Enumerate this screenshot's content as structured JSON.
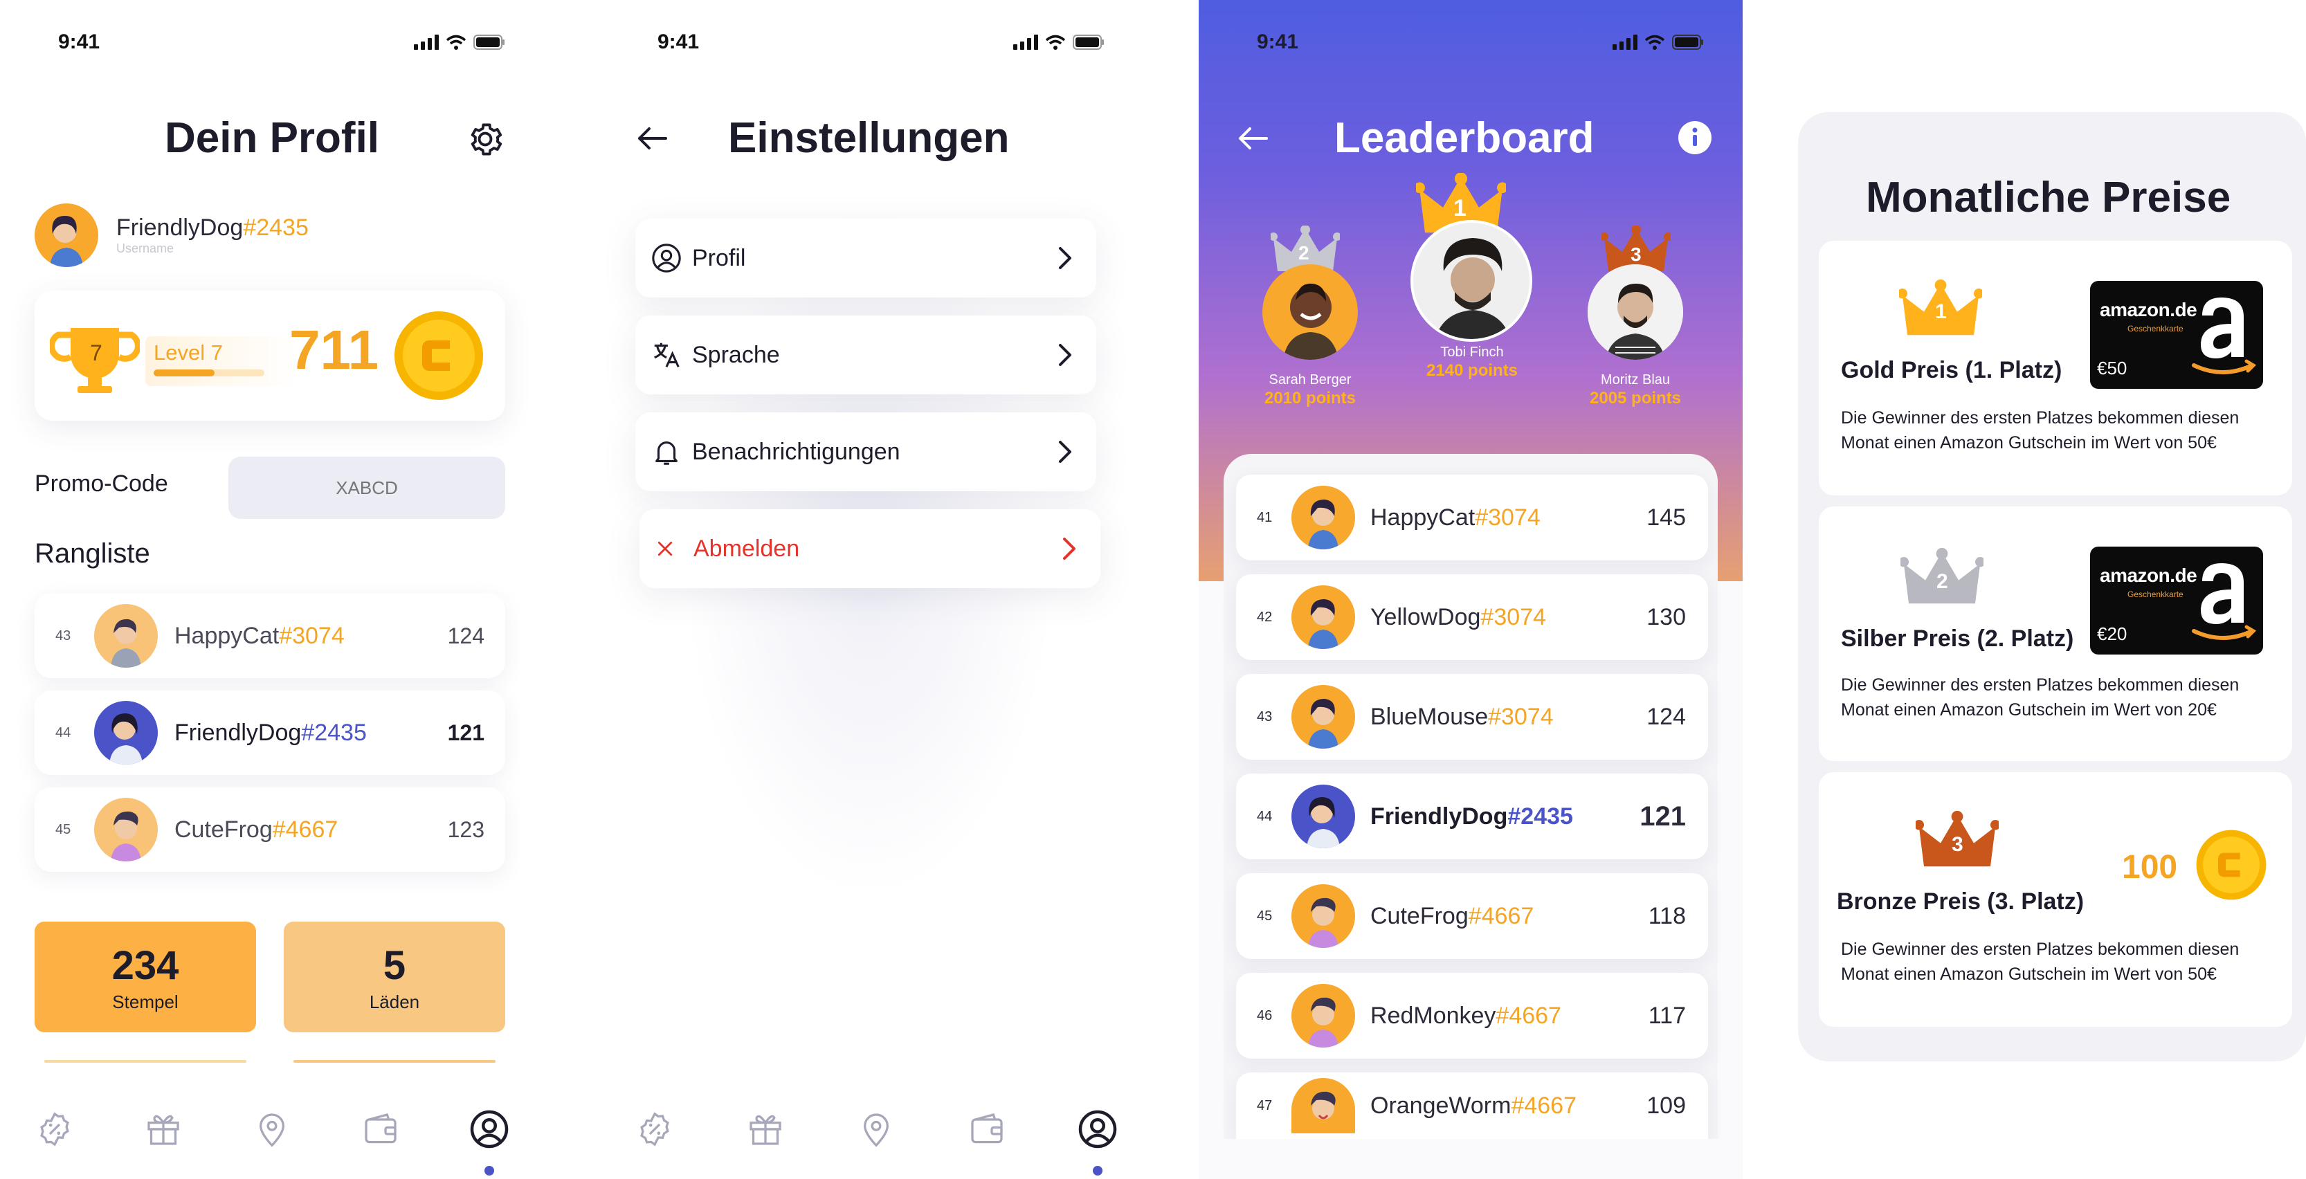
{
  "status": {
    "time": "9:41"
  },
  "profile": {
    "title": "Dein Profil",
    "user": {
      "name": "FriendlyDog",
      "tag": "#2435",
      "sub": "Username"
    },
    "level": {
      "badge": "7",
      "label": "Level 7",
      "progress": 0.55
    },
    "points": "711",
    "promo": {
      "label": "Promo-Code",
      "placeholder": "XABCD"
    },
    "ranking_title": "Rangliste",
    "ranking": [
      {
        "rank": "43",
        "name": "HappyCat",
        "tag": "#3074",
        "score": "124"
      },
      {
        "rank": "44",
        "name": "FriendlyDog",
        "tag": "#2435",
        "score": "121",
        "me": true
      },
      {
        "rank": "45",
        "name": "CuteFrog",
        "tag": "#4667",
        "score": "123"
      }
    ],
    "stats": [
      {
        "value": "234",
        "label": "Stempel",
        "color": "#fdb144"
      },
      {
        "value": "5",
        "label": "Läden",
        "color": "#f8c882"
      }
    ]
  },
  "settings": {
    "title": "Einstellungen",
    "items": [
      {
        "label": "Profil",
        "icon": "user-circle-icon"
      },
      {
        "label": "Sprache",
        "icon": "translate-icon"
      },
      {
        "label": "Benachrichtigungen",
        "icon": "bell-icon"
      },
      {
        "label": "Abmelden",
        "icon": "close-icon",
        "danger": true
      }
    ]
  },
  "leaderboard": {
    "title": "Leaderboard",
    "podium": [
      {
        "place": "1",
        "name": "Tobi Finch",
        "points": "2140 points"
      },
      {
        "place": "2",
        "name": "Sarah Berger",
        "points": "2010 points"
      },
      {
        "place": "3",
        "name": "Moritz Blau",
        "points": "2005 points"
      }
    ],
    "rows": [
      {
        "rank": "41",
        "name": "HappyCat",
        "tag": "#3074",
        "score": "145"
      },
      {
        "rank": "42",
        "name": "YellowDog",
        "tag": "#3074",
        "score": "130"
      },
      {
        "rank": "43",
        "name": "BlueMouse",
        "tag": "#3074",
        "score": "124"
      },
      {
        "rank": "44",
        "name": "FriendlyDog",
        "tag": "#2435",
        "score": "121",
        "me": true
      },
      {
        "rank": "45",
        "name": "CuteFrog",
        "tag": "#4667",
        "score": "118"
      },
      {
        "rank": "46",
        "name": "RedMonkey",
        "tag": "#4667",
        "score": "117"
      },
      {
        "rank": "47",
        "name": "OrangeWorm",
        "tag": "#4667",
        "score": "109"
      }
    ]
  },
  "prizes": {
    "title": "Monatliche Preise",
    "items": [
      {
        "place": "1",
        "title": "Gold Preis (1. Platz)",
        "desc": "Die Gewinner des ersten Platzes bekommen diesen Monat einen Amazon Gutschein im Wert von 50€",
        "card_value": "€50",
        "crown_color": "#ffb21c"
      },
      {
        "place": "2",
        "title": "Silber Preis (2. Platz)",
        "desc": "Die Gewinner des ersten Platzes bekommen diesen Monat einen Amazon Gutschein im Wert von 20€",
        "card_value": "€20",
        "crown_color": "#b8b8c0"
      },
      {
        "place": "3",
        "title": "Bronze Preis (3. Platz)",
        "desc": "Die Gewinner des ersten Platzes bekommen diesen Monat einen Amazon Gutschein im Wert von 50€",
        "coins": "100",
        "crown_color": "#c9561b"
      }
    ],
    "gift_brand": "amazon.de",
    "gift_sub": "Geschenkkarte"
  },
  "colors": {
    "accent": "#4a54c8",
    "orange": "#f5a524",
    "danger": "#e5322b"
  }
}
